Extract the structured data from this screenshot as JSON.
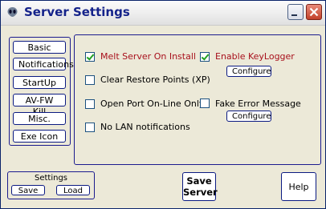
{
  "window": {
    "title": "Server Settings"
  },
  "nav": [
    "Basic",
    "Notifications",
    "StartUp",
    "AV-FW Kill",
    "Misc.",
    "Exe Icon"
  ],
  "options": [
    {
      "label": "Melt Server On Install",
      "checked": true
    },
    {
      "label": "Enable KeyLogger",
      "checked": true
    },
    {
      "label": "Clear Restore Points (XP)",
      "checked": false
    },
    {
      "label": "Open Port On-Line Only",
      "checked": false
    },
    {
      "label": "Fake Error Message",
      "checked": false
    },
    {
      "label": "No LAN notifications",
      "checked": false
    }
  ],
  "configure_label": "Configure",
  "settings": {
    "title": "Settings",
    "save": "Save",
    "load": "Load"
  },
  "save_server": {
    "line1": "Save",
    "line2": "Server"
  },
  "help": "Help",
  "colors": {
    "border": "#1b1b8e",
    "highlight_text": "#a8101c",
    "check": "#21a121"
  }
}
